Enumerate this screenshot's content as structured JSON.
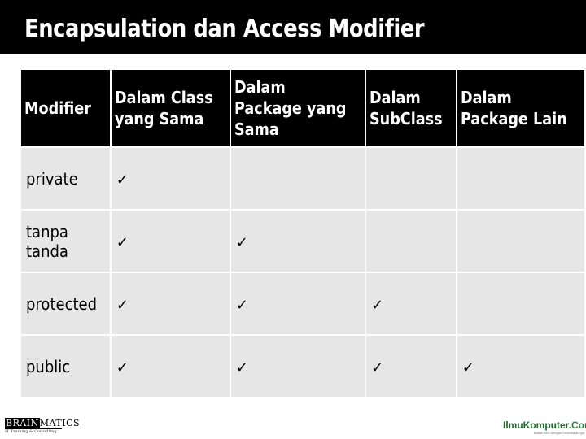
{
  "slide": {
    "title": "Encapsulation dan Access Modifier"
  },
  "table": {
    "headers": [
      [
        "Modifier"
      ],
      [
        "Dalam Class",
        "yang Sama"
      ],
      [
        "Dalam",
        "Package yang",
        "Sama"
      ],
      [
        "Dalam",
        "SubClass"
      ],
      [
        "Dalam",
        "Package Lain"
      ]
    ],
    "check_symbol": "✓",
    "rows": [
      {
        "modifier": "private",
        "access": [
          true,
          false,
          false,
          false
        ]
      },
      {
        "modifier": "tanpa tanda",
        "access": [
          true,
          true,
          false,
          false
        ]
      },
      {
        "modifier": "protected",
        "access": [
          true,
          true,
          true,
          false
        ]
      },
      {
        "modifier": "public",
        "access": [
          true,
          true,
          true,
          true
        ]
      }
    ]
  },
  "footer": {
    "left_logo": {
      "brand_highlight": "BRAIN",
      "brand_rest": "MATICS",
      "subtitle": "IT Training & Consulting"
    },
    "right_logo": {
      "name": "IlmuKomputer",
      "suffix": ".Com",
      "tagline": "ikatlah ilmu dengan menuliskannya"
    }
  }
}
